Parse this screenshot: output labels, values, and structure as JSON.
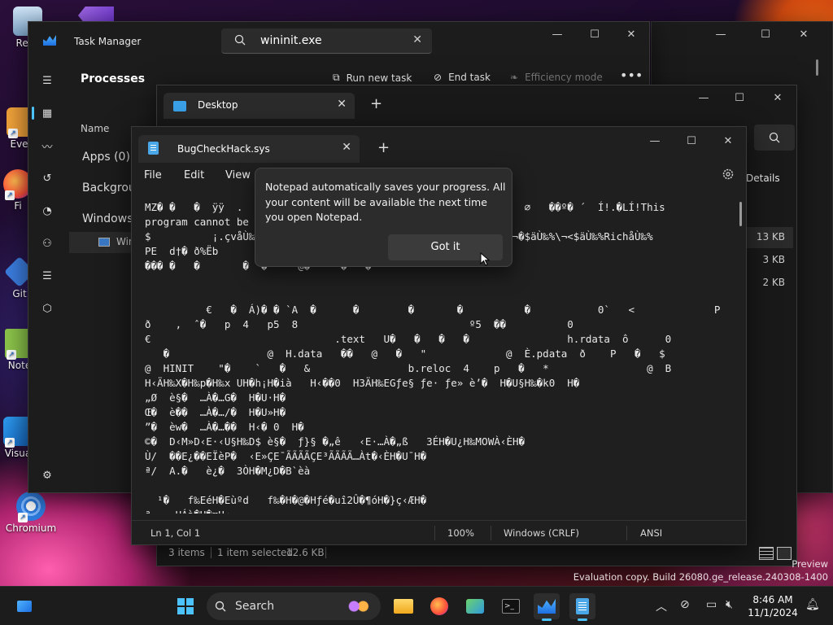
{
  "desktop": {
    "icons": [
      {
        "label": "Recy"
      },
      {
        "label": "Ever"
      },
      {
        "label": "Fi"
      },
      {
        "label": "Git"
      },
      {
        "label": "Note"
      },
      {
        "label": "Visua"
      },
      {
        "label": "Chromium"
      }
    ]
  },
  "taskmgr": {
    "title": "Task Manager",
    "search_value": "wininit.exe",
    "heading": "Processes",
    "run_new_task": "Run new task",
    "end_task": "End task",
    "efficiency_mode": "Efficiency mode",
    "col_name": "Name",
    "groups": [
      "Apps (0)",
      "Backgrou",
      "Windows"
    ],
    "row_label": "Win"
  },
  "explorer": {
    "tab_title": "Desktop",
    "details_label": "Details",
    "sizes": [
      "13 KB",
      "3 KB",
      "2 KB"
    ],
    "status_items": "3 items",
    "status_selected": "1 item selected",
    "status_size": "12.6 KB"
  },
  "notepad": {
    "tab_title": "BugCheckHack.sys",
    "menu": [
      "File",
      "Edit",
      "View"
    ],
    "content": "MZ� �   �  ÿÿ  .                                              ∅   ��º� ´  Í!.�LÍ!This\nprogram cannot be                                                                      \n$          ¡.çvåÙ‰%å                                ²�$àÙ‰%\\¬�$äÙ‰%\\¬<$äÙ‰%RichåÙ‰%\nPE  d†� ð%Ëb                                                                         \n��� �   �       �  �     @�     �   �                                                \n\n\n          €   �  Á)� � `A  �      �        �       �          �           0`   <             P\nð    ,  ˆ�   p  4   p5  8                            º5  ��          0\n€                              .text   U�   �   �   �                h.rdata  ô      0\n   �                @  H.data   ��   @   �   \"             @  È.pdata  ð    P   �   $\n@  HINIT    \"�    `   �   &                b.reloc  4    p   �   *                @  B\nH‹ÄH‰X�H‰p�H‰x UH�h¡H�ià   H‹��0  H3ÄH‰EGƒe§ ƒe· ƒe» è’�  H�U§H‰�k0  H�\n„Ø  è§�  …À�…G�  H�U·H�\nŒ�  è��  …À�…/�  H�U»H�\n”�  èw�  …À�…��  H‹� 0  H�\n©�  D‹M»D‹E·‹U§H‰D$ è§�  ƒ}§ �„ê   ‹E·…À�„ß   3ÉH�U¿H‰M߀WÀ‹ÈH�\nÙ/  ��E¿��EÏèP�  ‹E»ÇE¯ÃÃÃÃÇE³ÃÃÃÃ…Àt�‹ÈH�U¯H�\nª/  A.�   è¿�  3ÒH�M¿D�B`èà\n\n  ¹�   f‰EéH�Eùºd   f‰�H�@�Hƒé�uî2Û�¶óH�}ç‹ÆH�\nª    HÁà�H�æH‹",
    "status_pos": "Ln 1, Col 1",
    "status_zoom": "100%",
    "status_eol": "Windows (CRLF)",
    "status_enc": "ANSI"
  },
  "teaching_tip": {
    "message": "Notepad automatically saves your progress. All your content will be available the next time you open Notepad.",
    "button": "Got it"
  },
  "watermark": {
    "line1": "Preview",
    "line2": "Evaluation copy. Build 26080.ge_release.240308-1400"
  },
  "taskbar": {
    "search_label": "Search",
    "time": "8:46 AM",
    "date": "11/1/2024"
  },
  "colors": {
    "accent": "#4cc2ff",
    "window_bg": "#202020"
  }
}
